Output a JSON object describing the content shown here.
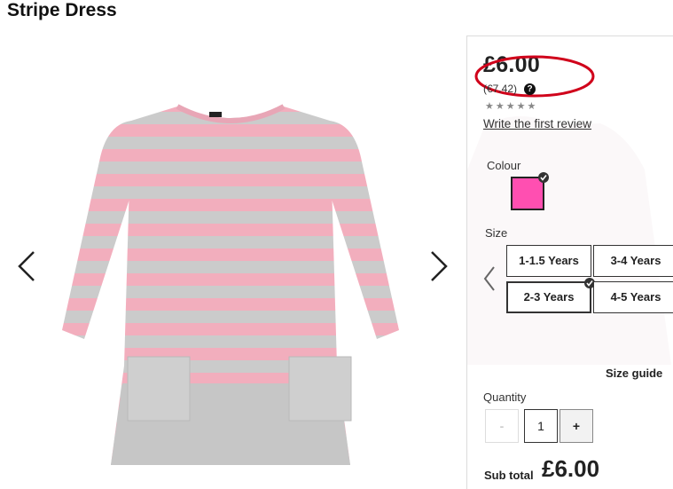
{
  "product": {
    "title": "Stripe Dress"
  },
  "gallery": {
    "prev_icon": "chevron-left-icon",
    "next_icon": "chevron-right-icon",
    "image": "striped-dress-image",
    "colors": {
      "pink": "#f2aebd",
      "grey": "#c9c9c9"
    }
  },
  "pricing": {
    "price": "£6.00",
    "euro_price": "(€7.42)",
    "help_icon": "?",
    "stars": "★★★★★",
    "review_link": "Write the first review",
    "highlight_color": "#d0021b"
  },
  "colour": {
    "label": "Colour",
    "selected_swatch": "#ff4fb1"
  },
  "size": {
    "label": "Size",
    "options": [
      "1-1.5 Years",
      "3-4 Years",
      "2-3 Years",
      "4-5 Years"
    ],
    "selected": "2-3 Years",
    "guide_label": "Size guide"
  },
  "quantity": {
    "label": "Quantity",
    "minus": "-",
    "value": "1",
    "plus": "+"
  },
  "subtotal": {
    "label": "Sub total",
    "value": "£6.00"
  }
}
